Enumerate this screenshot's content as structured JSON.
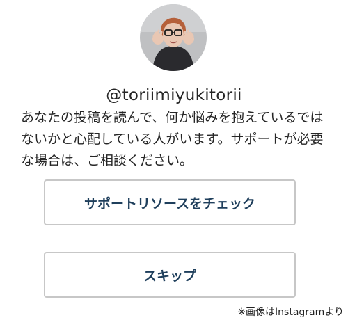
{
  "profile": {
    "username": "@toriimiyukitorii",
    "avatar": "profile-photo"
  },
  "message": "あなたの投稿を読んで、何か悩みを抱えているではないかと心配している人がいます。サポートが必要な場合は、ご相談ください。",
  "actions": {
    "support_label": "サポートリソースをチェック",
    "skip_label": "スキップ"
  },
  "credit": "※画像はInstagramより",
  "colors": {
    "button_text": "#1f3f5c",
    "button_border": "#c7c7c7"
  }
}
